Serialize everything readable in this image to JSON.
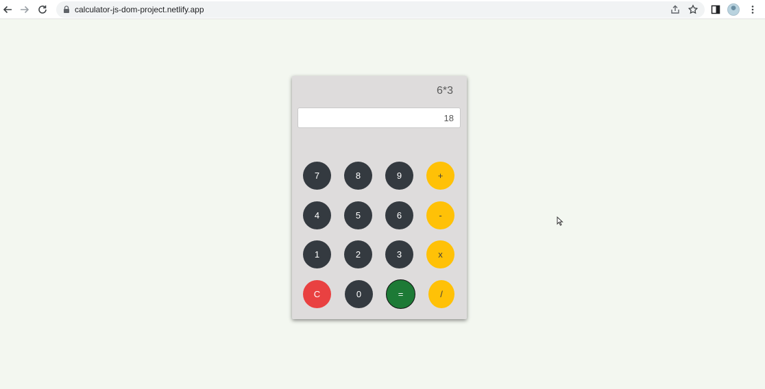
{
  "browser": {
    "url": "calculator-js-dom-project.netlify.app"
  },
  "calculator": {
    "expression": "6*3",
    "result": "18",
    "keys": [
      {
        "label": "7",
        "name": "key-7"
      },
      {
        "label": "8",
        "name": "key-8"
      },
      {
        "label": "9",
        "name": "key-9"
      },
      {
        "label": "+",
        "name": "key-plus"
      },
      {
        "label": "4",
        "name": "key-4"
      },
      {
        "label": "5",
        "name": "key-5"
      },
      {
        "label": "6",
        "name": "key-6"
      },
      {
        "label": "-",
        "name": "key-minus"
      },
      {
        "label": "1",
        "name": "key-1"
      },
      {
        "label": "2",
        "name": "key-2"
      },
      {
        "label": "3",
        "name": "key-3"
      },
      {
        "label": "x",
        "name": "key-multiply"
      },
      {
        "label": "C",
        "name": "key-clear"
      },
      {
        "label": "0",
        "name": "key-0"
      },
      {
        "label": "=",
        "name": "key-equals"
      },
      {
        "label": "/",
        "name": "key-divide"
      }
    ]
  },
  "colors": {
    "page_background": "#f3f7f0",
    "panel": "#dedcdc",
    "digit_key": "#343a40",
    "operator_key": "#ffc107",
    "clear_key": "#e94141",
    "equals_key": "#1d7a36"
  }
}
